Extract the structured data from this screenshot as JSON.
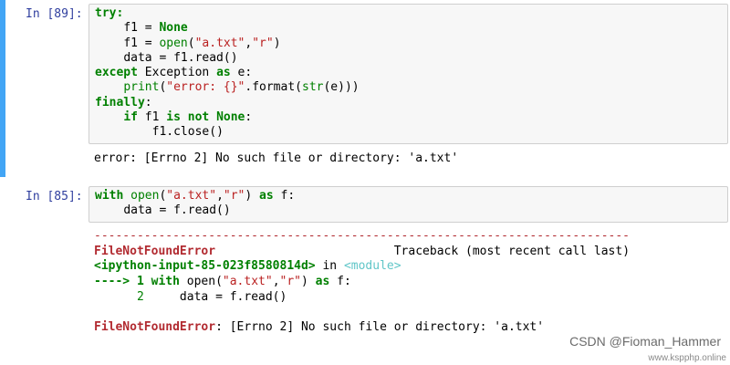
{
  "cells": [
    {
      "prompt": "In [89]:",
      "code": {
        "l1_try": "try:",
        "l2_var": "f1",
        "l2_eq": " = ",
        "l2_none": "None",
        "l3_var": "f1",
        "l3_eq": " = ",
        "l3_open": "open",
        "l3_p1": "(",
        "l3_s1": "\"a.txt\"",
        "l3_comma": ",",
        "l3_s2": "\"r\"",
        "l3_p2": ")",
        "l4_text": "data = f1.read()",
        "l5_except": "except",
        "l5_exc": " Exception ",
        "l5_as": "as",
        "l5_rest": " e:",
        "l6_print": "print",
        "l6_p1": "(",
        "l6_str": "\"error: {}\"",
        "l6_mid": ".format(",
        "l6_str2": "str",
        "l6_end": "(e)))",
        "l7_finally": "finally",
        "l7_colon": ":",
        "l8_if": "if",
        "l8_f1": " f1 ",
        "l8_is": "is",
        "l8_sp": " ",
        "l8_not": "not",
        "l8_sp2": " ",
        "l8_none": "None",
        "l8_colon": ":",
        "l9_text": "f1.close()"
      },
      "output": "error: [Errno 2] No such file or directory: 'a.txt'"
    },
    {
      "prompt": "In [85]:",
      "code": {
        "l1_with": "with",
        "l1_sp": " ",
        "l1_open": "open",
        "l1_p1": "(",
        "l1_s1": "\"a.txt\"",
        "l1_comma": ",",
        "l1_s2": "\"r\"",
        "l1_p2": ")",
        "l1_sp2": " ",
        "l1_as": "as",
        "l1_rest": " f:",
        "l2_text": "data = f.read()"
      },
      "traceback": {
        "dashes": "---------------------------------------------------------------------------",
        "error_name": "FileNotFoundError",
        "traceback_label": "Traceback (most recent call last)",
        "ipython_input": "<ipython-input-85-023f8580814d>",
        "in_word": " in ",
        "module": "<module>",
        "arrow": "----> 1 ",
        "with": "with",
        "open_part": " open(",
        "s1": "\"a.txt\"",
        "comma": ",",
        "s2": "\"r\"",
        "close_part": ") ",
        "as": "as",
        "f_part": " f:",
        "line2_num": "      2",
        "line2_code": "     data = f.read()",
        "final_error_name": "FileNotFoundError",
        "final_error_msg": ": [Errno 2] No such file or directory: 'a.txt'"
      }
    }
  ],
  "watermark": {
    "text": "CSDN @Fioman_Hammer",
    "subtext": "www.kspphp.online"
  },
  "colors": {
    "selection_bar": "#42a5f5",
    "prompt": "#303f9f",
    "keyword": "#008000",
    "string": "#ba2121",
    "error": "#b22b31",
    "operator_word": "#aa22ff"
  }
}
